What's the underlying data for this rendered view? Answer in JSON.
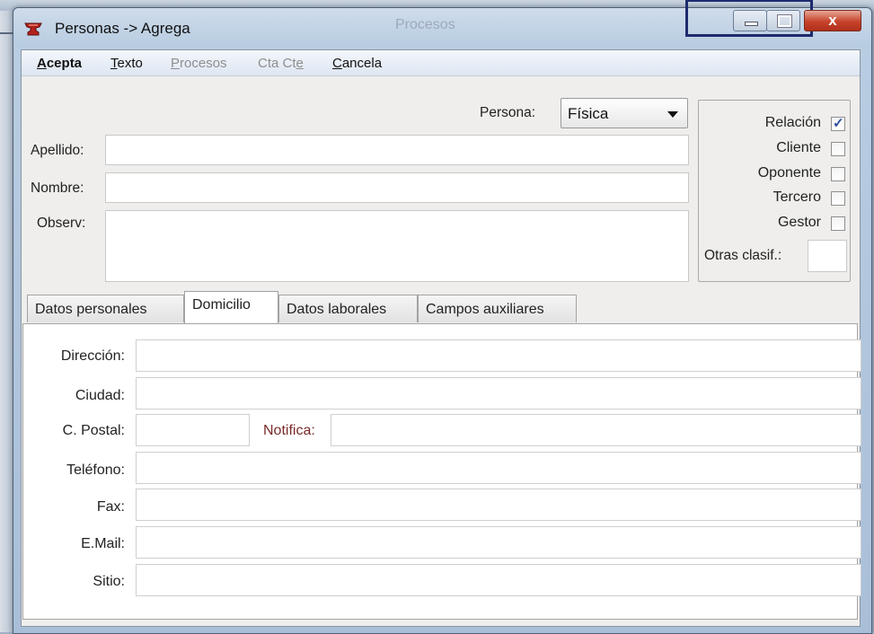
{
  "window": {
    "title": "Personas -> Agrega",
    "ghost_title": "Procesos",
    "close_glyph": "x",
    "icons": {
      "app": "anvil-icon",
      "minimize": "minimize-icon",
      "maximize": "maximize-icon",
      "close": "close-icon"
    }
  },
  "menu": {
    "acepta": {
      "pre": "",
      "u": "A",
      "post": "cepta"
    },
    "texto": {
      "pre": "",
      "u": "T",
      "post": "exto"
    },
    "procesos": {
      "pre": "",
      "u": "P",
      "post": "rocesos"
    },
    "ctacte": {
      "pre": "Cta Ct",
      "u": "e",
      "post": ""
    },
    "cancela": {
      "pre": "",
      "u": "C",
      "post": "ancela"
    }
  },
  "form": {
    "persona_label": "Persona:",
    "persona_value": "Física",
    "apellido_label": "Apellido:",
    "apellido_value": "",
    "nombre_label": "Nombre:",
    "nombre_value": "",
    "observ_label": "Observ:",
    "observ_value": ""
  },
  "clasificacion": {
    "relacion": {
      "label": "Relación",
      "checked": true
    },
    "cliente": {
      "label": "Cliente",
      "checked": false
    },
    "oponente": {
      "label": "Oponente",
      "checked": false
    },
    "tercero": {
      "label": "Tercero",
      "checked": false
    },
    "gestor": {
      "label": "Gestor",
      "checked": false
    },
    "otras_label": "Otras clasif.:",
    "otras_value": "",
    "check_glyph": "✓"
  },
  "tabs": {
    "datos_personales": "Datos personales",
    "domicilio": "Domicilio",
    "datos_laborales": "Datos laborales",
    "campos_auxiliares": "Campos auxiliares",
    "active": "Domicilio"
  },
  "domicilio": {
    "direccion_label": "Dirección:",
    "ciudad_label": "Ciudad:",
    "cpostal_label": "C. Postal:",
    "notifica_label": "Notifica:",
    "telefono_label": "Teléfono:",
    "fax_label": "Fax:",
    "email_label": "E.Mail:",
    "sitio_label": "Sitio:",
    "direccion_value": "",
    "ciudad_value": "",
    "cpostal_value": "",
    "notifica_value": "",
    "telefono_value": "",
    "fax_value": "",
    "email_value": "",
    "sitio_value": ""
  },
  "colors": {
    "notifica_label": "#7a2a2a",
    "close_button": "#c7422a",
    "checkbox_mark": "#2a4fa0"
  }
}
